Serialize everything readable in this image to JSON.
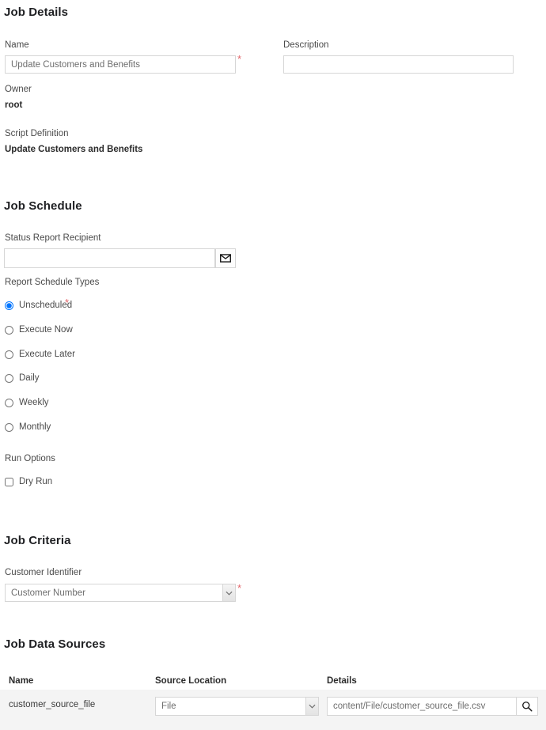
{
  "job_details": {
    "heading": "Job Details",
    "name_label": "Name",
    "name_value": "Update Customers and Benefits",
    "name_placeholder": "Update Customers and Benefits",
    "name_required_marker": "*",
    "description_label": "Description",
    "description_value": "",
    "description_placeholder": "",
    "owner_label": "Owner",
    "owner_value": "root",
    "script_definition_label": "Script Definition",
    "script_definition_value": "Update Customers and Benefits"
  },
  "job_schedule": {
    "heading": "Job Schedule",
    "recipient_label": "Status Report Recipient",
    "recipient_value": "",
    "recipient_placeholder": "",
    "email_icon": "envelope-icon",
    "schedule_types_label": "Report Schedule Types",
    "schedule_required_marker": "*",
    "schedule_options": [
      {
        "label": "Unscheduled",
        "selected": true
      },
      {
        "label": "Execute Now",
        "selected": false
      },
      {
        "label": "Execute Later",
        "selected": false
      },
      {
        "label": "Daily",
        "selected": false
      },
      {
        "label": "Weekly",
        "selected": false
      },
      {
        "label": "Monthly",
        "selected": false
      }
    ],
    "run_options_label": "Run Options",
    "dry_run_label": "Dry Run",
    "dry_run_checked": false
  },
  "job_criteria": {
    "heading": "Job Criteria",
    "customer_identifier_label": "Customer Identifier",
    "customer_identifier_value": "Customer Number",
    "customer_identifier_required_marker": "*",
    "dropdown_icon": "chevron-down-icon"
  },
  "job_data_sources": {
    "heading": "Job Data Sources",
    "columns": [
      "Name",
      "Source Location",
      "Details"
    ],
    "rows": [
      {
        "name": "customer_source_file",
        "source_location": "File",
        "details": "content/File/customer_source_file.csv",
        "details_placeholder": "content/File/customer_source_file.csv",
        "search_icon": "search-icon"
      }
    ]
  },
  "colors": {
    "required_asterisk": "#e2656a",
    "heading": "#1f2023",
    "label": "#4a4a4a",
    "border": "#d6d6d6",
    "row_background": "#f4f4f4"
  }
}
